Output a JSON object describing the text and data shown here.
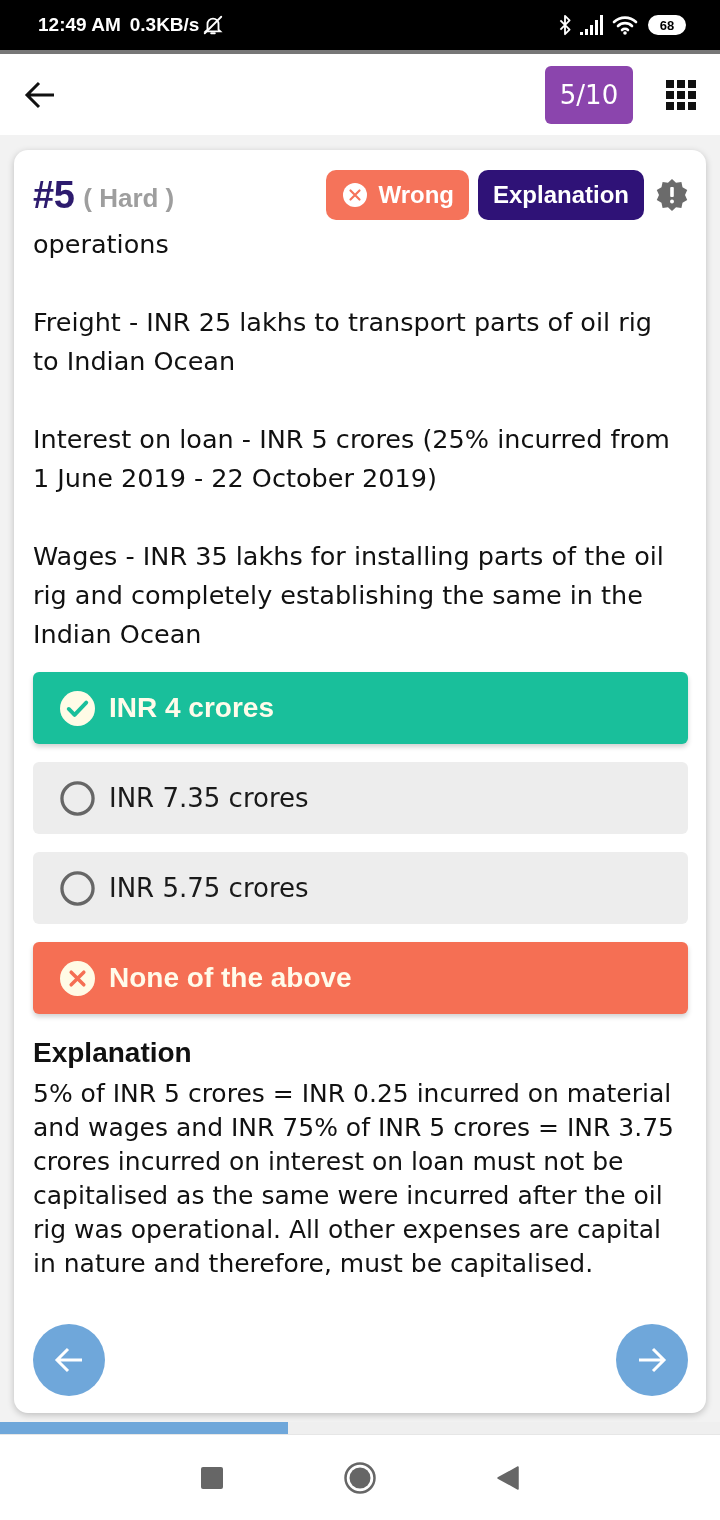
{
  "status_bar": {
    "time": "12:49 AM",
    "net_speed": "0.3KB/s",
    "battery": "68"
  },
  "top_bar": {
    "counter": "5/10"
  },
  "question": {
    "number": "#5",
    "difficulty": "( Hard )",
    "result": {
      "kind": "wrong",
      "label": "Wrong"
    },
    "explanation_button": "Explanation",
    "paragraphs": [
      "operations",
      "Freight - INR 25 lakhs to transport parts of oil rig to Indian Ocean",
      "Interest on loan - INR 5 crores (25% incurred from 1 June 2019 - 22 October 2019)",
      "Wages - INR 35 lakhs for installing parts of the oil rig and completely establishing the same in the Indian Ocean"
    ]
  },
  "options": [
    {
      "kind": "correct",
      "text": "INR 4 crores"
    },
    {
      "kind": "neutral",
      "text": "INR 7.35 crores"
    },
    {
      "kind": "neutral",
      "text": "INR 5.75 crores"
    },
    {
      "kind": "wrong",
      "text": "None of the above"
    }
  ],
  "explanation": {
    "heading": "Explanation",
    "text": "5% of INR 5 crores = INR 0.25 incurred on material and wages and INR 75% of INR 5 crores = INR 3.75 crores incurred on interest on loan must not be capitalised as the same were incurred after the oil rig was operational. All other expenses are capital in nature and therefore, must be capitalised."
  },
  "progress": {
    "level": 0.4
  }
}
